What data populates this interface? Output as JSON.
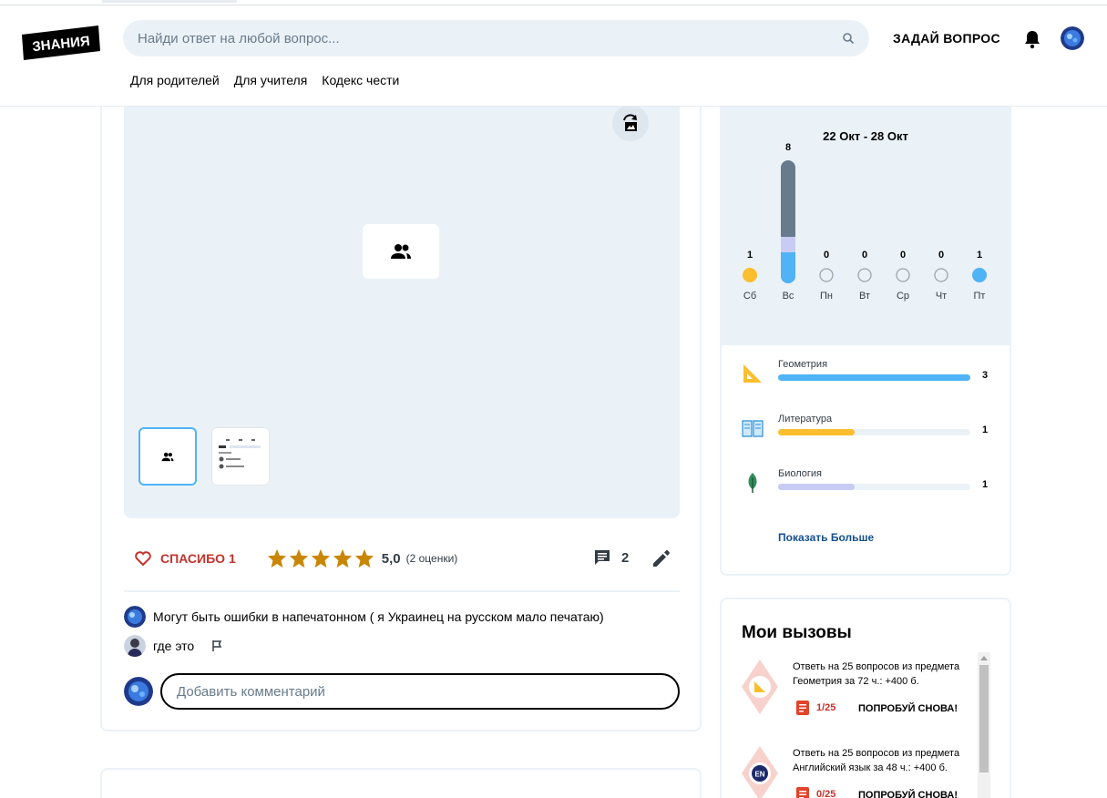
{
  "header": {
    "logo_text": "ЗНАНИЯ",
    "search_placeholder": "Найди ответ на любой вопрос...",
    "ask_label": "ЗАДАЙ ВОПРОС",
    "nav": [
      "Для родителей",
      "Для учителя",
      "Кодекс чести"
    ]
  },
  "answer": {
    "thanks_label": "СПАСИБО 1",
    "rating_value": "5,0",
    "rating_count": "(2 оценки)",
    "stars": 5,
    "comments_count": "2"
  },
  "comments": [
    {
      "text": "Могут быть ошибки в напечатонном ( я Украинец на русском мало печатаю)"
    },
    {
      "text": "где это"
    }
  ],
  "add_comment_placeholder": "Добавить комментарий",
  "activity": {
    "date_range": "22 Окт - 28 Окт",
    "days": [
      {
        "label": "Сб",
        "value": "1"
      },
      {
        "label": "Вс",
        "value": "8"
      },
      {
        "label": "Пн",
        "value": "0"
      },
      {
        "label": "Вт",
        "value": "0"
      },
      {
        "label": "Ср",
        "value": "0"
      },
      {
        "label": "Чт",
        "value": "0"
      },
      {
        "label": "Пт",
        "value": "1"
      }
    ],
    "subjects": [
      {
        "name": "Геометрия",
        "value": "3",
        "fraction": 1.0,
        "color": "#4fb3f6"
      },
      {
        "name": "Литература",
        "value": "1",
        "fraction": 0.4,
        "color": "#fbbe2e"
      },
      {
        "name": "Биология",
        "value": "1",
        "fraction": 0.4,
        "color": "#c8ccf5"
      }
    ],
    "show_more": "Показать Больше"
  },
  "challenges": {
    "title": "Мои вызовы",
    "items": [
      {
        "line1": "Ответь на 25 вопросов из предмета",
        "line2": "Геометрия за 72 ч.: +400 б.",
        "progress": "1/25",
        "retry": "ПОПРОБУЙ СНОВА!"
      },
      {
        "line1": "Ответь на 25 вопросов из предмета",
        "line2": "Английский язык за 48 ч.: +400 б.",
        "progress": "0/25",
        "retry": "ПОПРОБУЙ СНОВА!",
        "badge": "EN"
      }
    ]
  },
  "colors": {
    "accent_red": "#c3332d",
    "star": "#c98600",
    "blue": "#4fb3f6",
    "yellow": "#fbbe2e",
    "grey_bar": "#687b8c",
    "lavender": "#c8ccf5"
  }
}
